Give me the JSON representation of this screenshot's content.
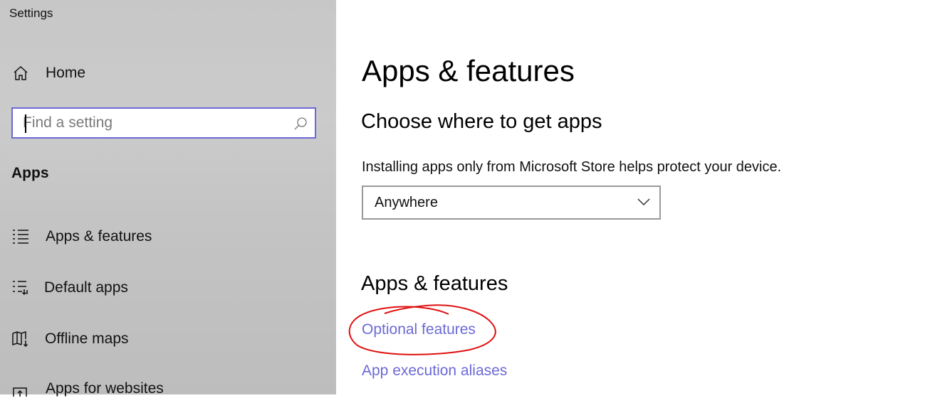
{
  "window": {
    "title": "Settings"
  },
  "sidebar": {
    "home_label": "Home",
    "search": {
      "placeholder": "Find a setting",
      "value": ""
    },
    "section_label": "Apps",
    "items": [
      {
        "label": "Apps & features",
        "icon": "apps-features-icon"
      },
      {
        "label": "Default apps",
        "icon": "default-apps-icon"
      },
      {
        "label": "Offline maps",
        "icon": "offline-maps-icon"
      },
      {
        "label": "Apps for websites",
        "icon": "apps-for-websites-icon"
      }
    ]
  },
  "main": {
    "title": "Apps & features",
    "choose_heading": "Choose where to get apps",
    "choose_description": "Installing apps only from Microsoft Store helps protect your device.",
    "source_dropdown": {
      "selected": "Anywhere"
    },
    "features_heading": "Apps & features",
    "links": {
      "optional_features": "Optional features",
      "app_execution_aliases": "App execution aliases"
    }
  },
  "colors": {
    "accent": "#6b69d6",
    "annotation": "#e01010",
    "sidebar_bg": "#c6c6c6"
  }
}
